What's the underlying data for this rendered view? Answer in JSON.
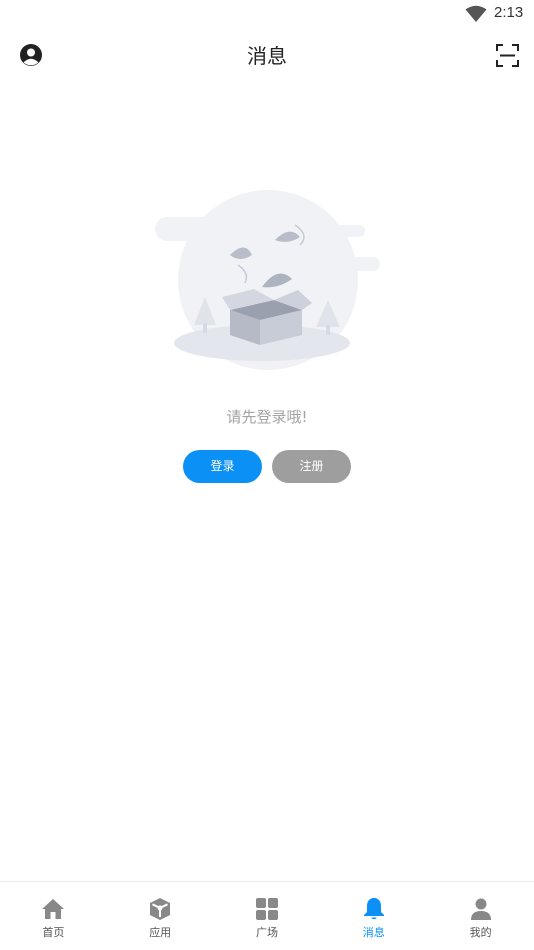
{
  "status": {
    "time": "2:13"
  },
  "header": {
    "title": "消息"
  },
  "empty_state": {
    "message": "请先登录哦!"
  },
  "actions": {
    "login_label": "登录",
    "register_label": "注册"
  },
  "tabs": [
    {
      "label": "首页",
      "icon": "home-icon"
    },
    {
      "label": "应用",
      "icon": "cube-icon"
    },
    {
      "label": "广场",
      "icon": "grid-icon"
    },
    {
      "label": "消息",
      "icon": "bell-icon",
      "active": true
    },
    {
      "label": "我的",
      "icon": "person-icon"
    }
  ],
  "colors": {
    "accent": "#0b90f5",
    "secondary_button": "#9e9e9e",
    "inactive_icon": "#888888"
  }
}
